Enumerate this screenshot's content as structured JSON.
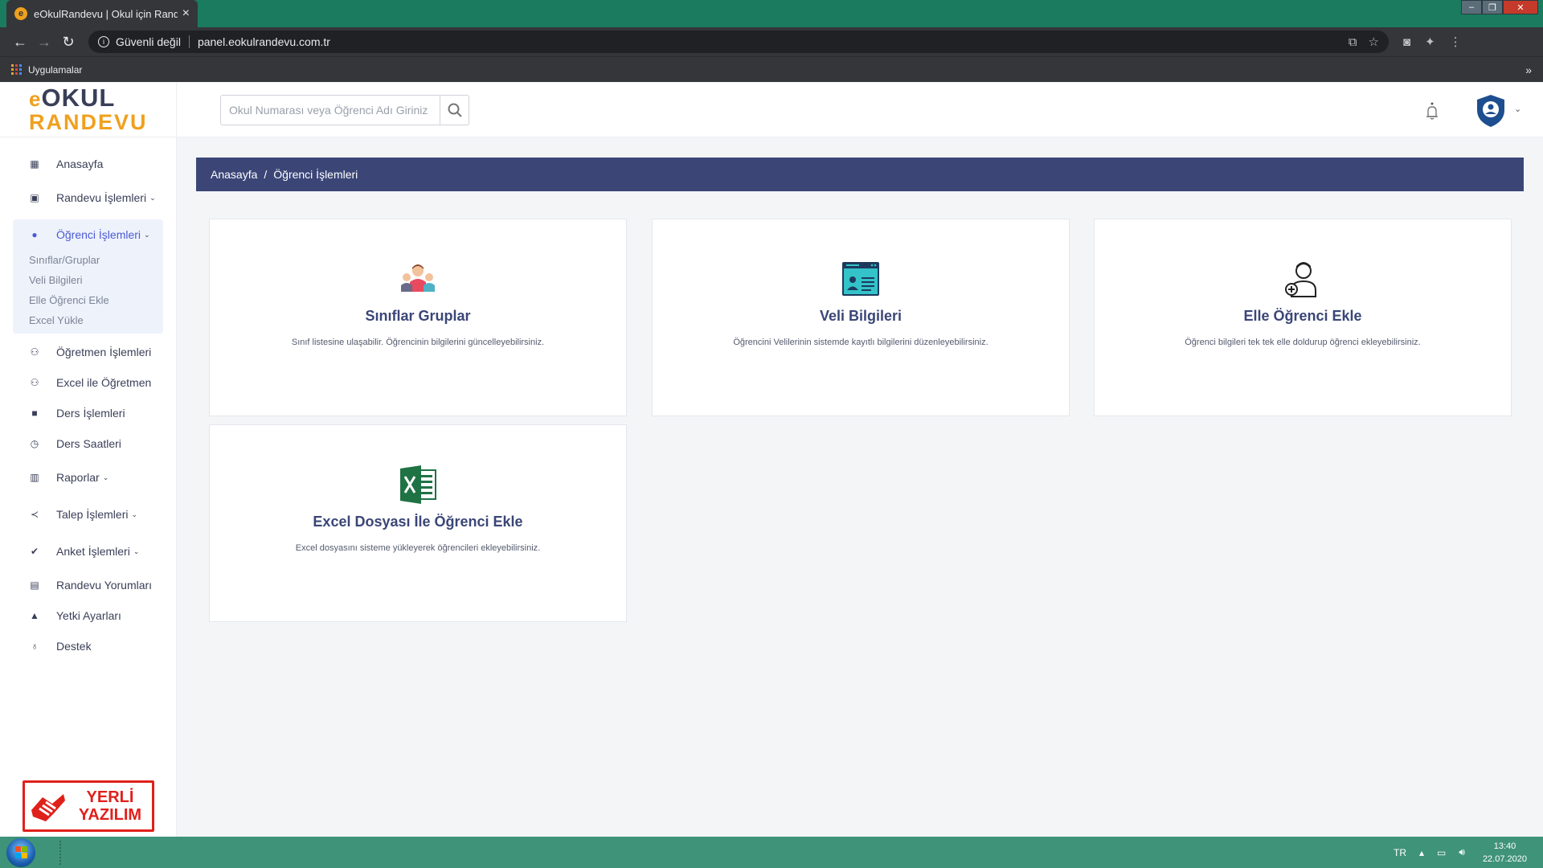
{
  "browser": {
    "tab_title": "eOkulRandevu | Okul için Randevu",
    "tab_favicon": "e",
    "security_label": "Güvenli değil",
    "url": "panel.eokulrandevu.com.tr",
    "bookmarks_label": "Uygulamalar",
    "bookmarks_more": "»"
  },
  "logo": {
    "top_e": "e",
    "top_rest": "OKUL",
    "bottom": "RANDEVU"
  },
  "sidebar": {
    "items_before": [
      {
        "label": "Anasayfa",
        "icon": "▦",
        "name": "dashboard-icon"
      },
      {
        "label": "Randevu İşlemleri",
        "icon": "▣",
        "name": "calendar-icon",
        "chevron": "⌄"
      }
    ],
    "active": {
      "label": "Öğrenci İşlemleri",
      "icon": "●",
      "chevron": "⌄"
    },
    "sub_items": [
      "Sınıflar/Gruplar",
      "Veli Bilgileri",
      "Elle Öğrenci Ekle",
      "Excel Yükle"
    ],
    "items_after": [
      {
        "label": "Öğretmen İşlemleri",
        "icon": "⚇"
      },
      {
        "label": "Excel ile Öğretmen",
        "icon": "⚇"
      },
      {
        "label": "Ders İşlemleri",
        "icon": "■"
      },
      {
        "label": "Ders Saatleri",
        "icon": "◷"
      },
      {
        "label": "Raporlar",
        "icon": "▥",
        "chevron": "⌄"
      },
      {
        "label": "Talep İşlemleri",
        "icon": "≺",
        "chevron": "⌄"
      },
      {
        "label": "Anket İşlemleri",
        "icon": "✔",
        "chevron": "⌄"
      },
      {
        "label": "Randevu Yorumları",
        "icon": "▤"
      },
      {
        "label": "Yetki Ayarları",
        "icon": "▲"
      },
      {
        "label": "Destek",
        "icon": "♁"
      }
    ],
    "badge_line1": "YERLİ",
    "badge_line2": "YAZILIM"
  },
  "search": {
    "placeholder": "Okul Numarası veya Öğrenci Adı Giriniz"
  },
  "breadcrumb": {
    "home": "Anasayfa",
    "separator": "/",
    "current": "Öğrenci İşlemleri"
  },
  "cards": [
    {
      "title": "Sınıflar Gruplar",
      "desc": "Sınıf listesine ulaşabilir. Öğrencinin bilgilerini güncelleyebilirsiniz."
    },
    {
      "title": "Veli Bilgileri",
      "desc": "Öğrencini Velilerinin sistemde kayıtlı bilgilerini düzenleyebilirsiniz."
    },
    {
      "title": "Elle Öğrenci Ekle",
      "desc": "Öğrenci bilgileri tek tek elle doldurup öğrenci ekleyebilirsiniz."
    },
    {
      "title": "Excel Dosyası İle Öğrenci Ekle",
      "desc": "Excel dosyasını sisteme yükleyerek öğrencileri ekleyebilirsiniz."
    }
  ],
  "taskbar": {
    "lang": "TR",
    "time": "13:40",
    "date": "22.07.2020"
  },
  "colors": {
    "primary": "#3b4677",
    "accent": "#f0a01e",
    "active": "#4a5bd4",
    "badge": "#e0201b"
  }
}
